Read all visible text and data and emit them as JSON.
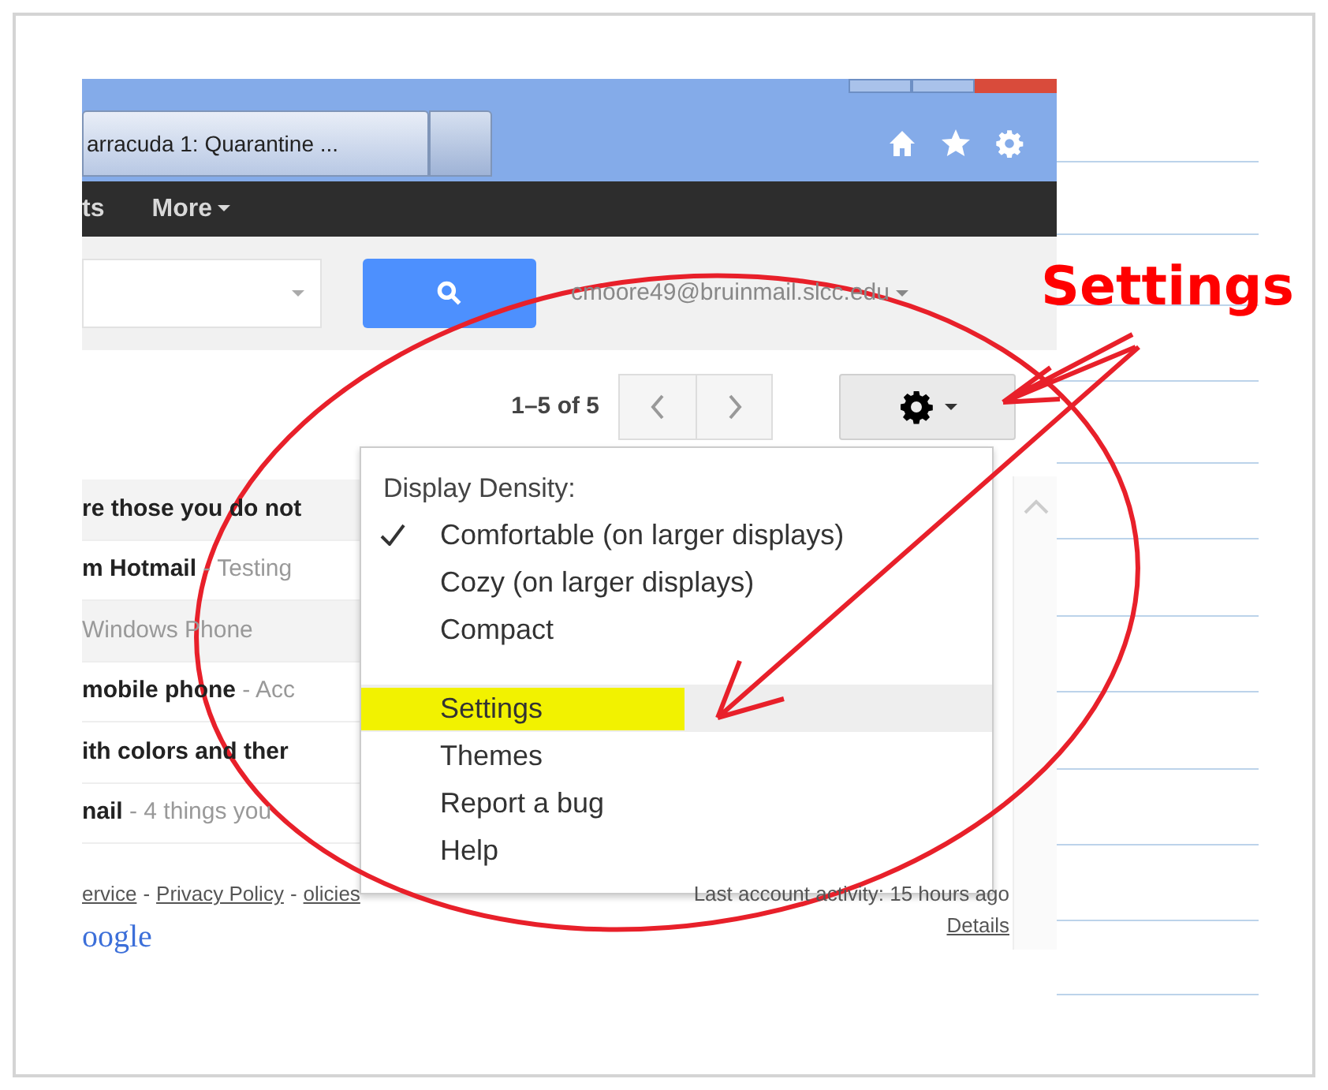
{
  "browser": {
    "tab_title": "arracuda 1: Quarantine ..."
  },
  "nav": {
    "items": [
      {
        "label": "ts",
        "menu": false
      },
      {
        "label": "More",
        "menu": true
      }
    ]
  },
  "account": {
    "email": "cmoore49@bruinmail.slcc.edu"
  },
  "toolbar": {
    "count": "1–5 of 5"
  },
  "messages": [
    {
      "bold": "re those you do not",
      "shaded": true
    },
    {
      "bold": "m Hotmail",
      "rest": " - Testing",
      "shaded": false
    },
    {
      "rest": "Windows Phone",
      "shaded": true
    },
    {
      "bold": "mobile phone",
      "rest": " - Acc",
      "shaded": false
    },
    {
      "bold": "ith colors and ther",
      "shaded": false
    },
    {
      "bold": "nail",
      "rest": " - 4 things you",
      "shaded": false
    }
  ],
  "footer": {
    "links": [
      {
        "kind": "link",
        "text": "ervice"
      },
      {
        "kind": "separator",
        "text": "-"
      },
      {
        "kind": "link",
        "text": "Privacy Policy"
      },
      {
        "kind": "separator",
        "text": "-"
      },
      {
        "kind": "link",
        "text": "olicies"
      }
    ],
    "activity": "Last account activity: 15 hours ago",
    "details": "Details",
    "logo": "oogle"
  },
  "settings_menu": {
    "heading": "Display Density:",
    "items": [
      {
        "kind": "density",
        "label": "Comfortable (on larger displays)",
        "checked": true
      },
      {
        "kind": "density",
        "label": "Cozy (on larger displays)",
        "checked": false
      },
      {
        "kind": "density",
        "label": "Compact",
        "checked": false
      },
      {
        "kind": "action",
        "label": "Settings",
        "highlighted": true
      },
      {
        "kind": "action",
        "label": "Themes",
        "highlighted": false
      },
      {
        "kind": "action",
        "label": "Report a bug",
        "highlighted": false
      },
      {
        "kind": "action",
        "label": "Help",
        "highlighted": false
      }
    ]
  },
  "annotation": {
    "label": "Settings"
  }
}
